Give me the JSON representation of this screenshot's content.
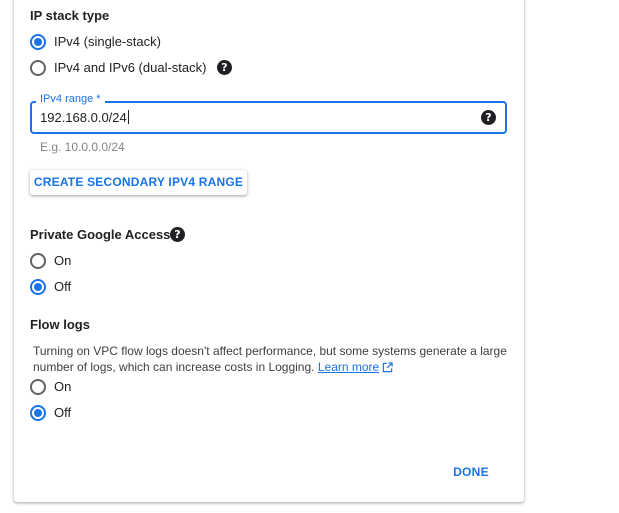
{
  "ip_stack": {
    "heading": "IP stack type",
    "options": [
      {
        "label": "IPv4 (single-stack)",
        "selected": true
      },
      {
        "label": "IPv4 and IPv6 (dual-stack)",
        "selected": false
      }
    ],
    "help_icon": "help-circle-icon"
  },
  "ipv4_range": {
    "label": "IPv4 range *",
    "value": "192.168.0.0/24",
    "hint": "E.g. 10.0.0.0/24",
    "help_icon": "help-circle-icon"
  },
  "secondary_range_button": "CREATE SECONDARY IPV4 RANGE",
  "private_access": {
    "heading": "Private Google Access",
    "options": [
      {
        "label": "On",
        "selected": false
      },
      {
        "label": "Off",
        "selected": true
      }
    ],
    "help_icon": "help-circle-icon"
  },
  "flow_logs": {
    "heading": "Flow logs",
    "description": "Turning on VPC flow logs doesn't affect performance, but some systems generate a large number of logs, which can increase costs in Logging.",
    "learn_more": "Learn more",
    "link_icon": "external-link-icon",
    "options": [
      {
        "label": "On",
        "selected": false
      },
      {
        "label": "Off",
        "selected": true
      }
    ]
  },
  "done_button": "DONE",
  "colors": {
    "accent": "#1a73e8",
    "text": "#202124",
    "hint": "#80868b"
  }
}
